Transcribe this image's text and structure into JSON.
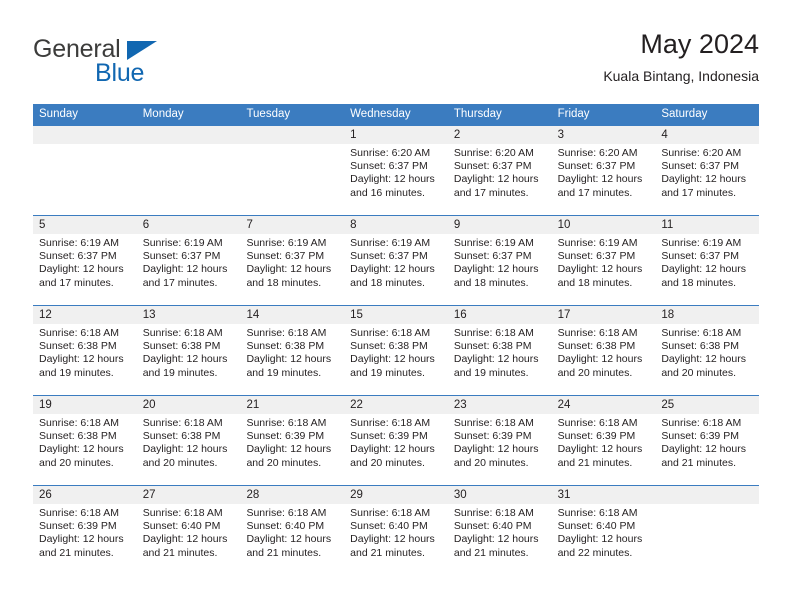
{
  "brand": {
    "name_part1": "General",
    "name_part2": "Blue",
    "triangle_icon": "triangle-icon",
    "primary_color": "#1167b1"
  },
  "header": {
    "title": "May 2024",
    "subtitle": "Kuala Bintang, Indonesia"
  },
  "theme": {
    "header_blue": "#3b7cc0",
    "day_band_gray": "#f0f0f0",
    "text_color": "#231f20"
  },
  "weekdays": [
    "Sunday",
    "Monday",
    "Tuesday",
    "Wednesday",
    "Thursday",
    "Friday",
    "Saturday"
  ],
  "weeks": [
    [
      {
        "date": "",
        "sunrise": "",
        "sunset": "",
        "daylight_line1": "",
        "daylight_line2": ""
      },
      {
        "date": "",
        "sunrise": "",
        "sunset": "",
        "daylight_line1": "",
        "daylight_line2": ""
      },
      {
        "date": "",
        "sunrise": "",
        "sunset": "",
        "daylight_line1": "",
        "daylight_line2": ""
      },
      {
        "date": "1",
        "sunrise": "Sunrise: 6:20 AM",
        "sunset": "Sunset: 6:37 PM",
        "daylight_line1": "Daylight: 12 hours",
        "daylight_line2": "and 16 minutes."
      },
      {
        "date": "2",
        "sunrise": "Sunrise: 6:20 AM",
        "sunset": "Sunset: 6:37 PM",
        "daylight_line1": "Daylight: 12 hours",
        "daylight_line2": "and 17 minutes."
      },
      {
        "date": "3",
        "sunrise": "Sunrise: 6:20 AM",
        "sunset": "Sunset: 6:37 PM",
        "daylight_line1": "Daylight: 12 hours",
        "daylight_line2": "and 17 minutes."
      },
      {
        "date": "4",
        "sunrise": "Sunrise: 6:20 AM",
        "sunset": "Sunset: 6:37 PM",
        "daylight_line1": "Daylight: 12 hours",
        "daylight_line2": "and 17 minutes."
      }
    ],
    [
      {
        "date": "5",
        "sunrise": "Sunrise: 6:19 AM",
        "sunset": "Sunset: 6:37 PM",
        "daylight_line1": "Daylight: 12 hours",
        "daylight_line2": "and 17 minutes."
      },
      {
        "date": "6",
        "sunrise": "Sunrise: 6:19 AM",
        "sunset": "Sunset: 6:37 PM",
        "daylight_line1": "Daylight: 12 hours",
        "daylight_line2": "and 17 minutes."
      },
      {
        "date": "7",
        "sunrise": "Sunrise: 6:19 AM",
        "sunset": "Sunset: 6:37 PM",
        "daylight_line1": "Daylight: 12 hours",
        "daylight_line2": "and 18 minutes."
      },
      {
        "date": "8",
        "sunrise": "Sunrise: 6:19 AM",
        "sunset": "Sunset: 6:37 PM",
        "daylight_line1": "Daylight: 12 hours",
        "daylight_line2": "and 18 minutes."
      },
      {
        "date": "9",
        "sunrise": "Sunrise: 6:19 AM",
        "sunset": "Sunset: 6:37 PM",
        "daylight_line1": "Daylight: 12 hours",
        "daylight_line2": "and 18 minutes."
      },
      {
        "date": "10",
        "sunrise": "Sunrise: 6:19 AM",
        "sunset": "Sunset: 6:37 PM",
        "daylight_line1": "Daylight: 12 hours",
        "daylight_line2": "and 18 minutes."
      },
      {
        "date": "11",
        "sunrise": "Sunrise: 6:19 AM",
        "sunset": "Sunset: 6:37 PM",
        "daylight_line1": "Daylight: 12 hours",
        "daylight_line2": "and 18 minutes."
      }
    ],
    [
      {
        "date": "12",
        "sunrise": "Sunrise: 6:18 AM",
        "sunset": "Sunset: 6:38 PM",
        "daylight_line1": "Daylight: 12 hours",
        "daylight_line2": "and 19 minutes."
      },
      {
        "date": "13",
        "sunrise": "Sunrise: 6:18 AM",
        "sunset": "Sunset: 6:38 PM",
        "daylight_line1": "Daylight: 12 hours",
        "daylight_line2": "and 19 minutes."
      },
      {
        "date": "14",
        "sunrise": "Sunrise: 6:18 AM",
        "sunset": "Sunset: 6:38 PM",
        "daylight_line1": "Daylight: 12 hours",
        "daylight_line2": "and 19 minutes."
      },
      {
        "date": "15",
        "sunrise": "Sunrise: 6:18 AM",
        "sunset": "Sunset: 6:38 PM",
        "daylight_line1": "Daylight: 12 hours",
        "daylight_line2": "and 19 minutes."
      },
      {
        "date": "16",
        "sunrise": "Sunrise: 6:18 AM",
        "sunset": "Sunset: 6:38 PM",
        "daylight_line1": "Daylight: 12 hours",
        "daylight_line2": "and 19 minutes."
      },
      {
        "date": "17",
        "sunrise": "Sunrise: 6:18 AM",
        "sunset": "Sunset: 6:38 PM",
        "daylight_line1": "Daylight: 12 hours",
        "daylight_line2": "and 20 minutes."
      },
      {
        "date": "18",
        "sunrise": "Sunrise: 6:18 AM",
        "sunset": "Sunset: 6:38 PM",
        "daylight_line1": "Daylight: 12 hours",
        "daylight_line2": "and 20 minutes."
      }
    ],
    [
      {
        "date": "19",
        "sunrise": "Sunrise: 6:18 AM",
        "sunset": "Sunset: 6:38 PM",
        "daylight_line1": "Daylight: 12 hours",
        "daylight_line2": "and 20 minutes."
      },
      {
        "date": "20",
        "sunrise": "Sunrise: 6:18 AM",
        "sunset": "Sunset: 6:38 PM",
        "daylight_line1": "Daylight: 12 hours",
        "daylight_line2": "and 20 minutes."
      },
      {
        "date": "21",
        "sunrise": "Sunrise: 6:18 AM",
        "sunset": "Sunset: 6:39 PM",
        "daylight_line1": "Daylight: 12 hours",
        "daylight_line2": "and 20 minutes."
      },
      {
        "date": "22",
        "sunrise": "Sunrise: 6:18 AM",
        "sunset": "Sunset: 6:39 PM",
        "daylight_line1": "Daylight: 12 hours",
        "daylight_line2": "and 20 minutes."
      },
      {
        "date": "23",
        "sunrise": "Sunrise: 6:18 AM",
        "sunset": "Sunset: 6:39 PM",
        "daylight_line1": "Daylight: 12 hours",
        "daylight_line2": "and 20 minutes."
      },
      {
        "date": "24",
        "sunrise": "Sunrise: 6:18 AM",
        "sunset": "Sunset: 6:39 PM",
        "daylight_line1": "Daylight: 12 hours",
        "daylight_line2": "and 21 minutes."
      },
      {
        "date": "25",
        "sunrise": "Sunrise: 6:18 AM",
        "sunset": "Sunset: 6:39 PM",
        "daylight_line1": "Daylight: 12 hours",
        "daylight_line2": "and 21 minutes."
      }
    ],
    [
      {
        "date": "26",
        "sunrise": "Sunrise: 6:18 AM",
        "sunset": "Sunset: 6:39 PM",
        "daylight_line1": "Daylight: 12 hours",
        "daylight_line2": "and 21 minutes."
      },
      {
        "date": "27",
        "sunrise": "Sunrise: 6:18 AM",
        "sunset": "Sunset: 6:40 PM",
        "daylight_line1": "Daylight: 12 hours",
        "daylight_line2": "and 21 minutes."
      },
      {
        "date": "28",
        "sunrise": "Sunrise: 6:18 AM",
        "sunset": "Sunset: 6:40 PM",
        "daylight_line1": "Daylight: 12 hours",
        "daylight_line2": "and 21 minutes."
      },
      {
        "date": "29",
        "sunrise": "Sunrise: 6:18 AM",
        "sunset": "Sunset: 6:40 PM",
        "daylight_line1": "Daylight: 12 hours",
        "daylight_line2": "and 21 minutes."
      },
      {
        "date": "30",
        "sunrise": "Sunrise: 6:18 AM",
        "sunset": "Sunset: 6:40 PM",
        "daylight_line1": "Daylight: 12 hours",
        "daylight_line2": "and 21 minutes."
      },
      {
        "date": "31",
        "sunrise": "Sunrise: 6:18 AM",
        "sunset": "Sunset: 6:40 PM",
        "daylight_line1": "Daylight: 12 hours",
        "daylight_line2": "and 22 minutes."
      },
      {
        "date": "",
        "sunrise": "",
        "sunset": "",
        "daylight_line1": "",
        "daylight_line2": ""
      }
    ]
  ]
}
